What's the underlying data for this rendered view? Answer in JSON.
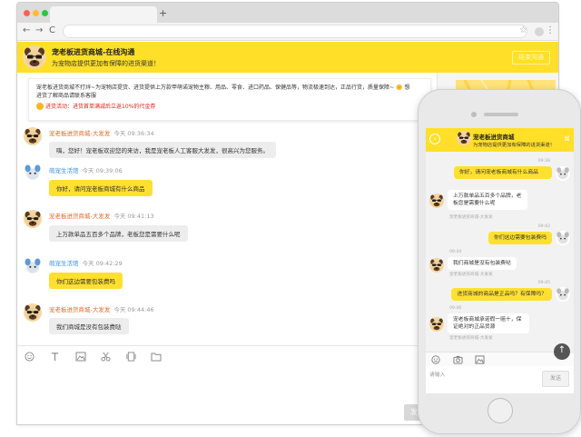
{
  "browser": {
    "new_tab": "+",
    "nav": {
      "back": "←",
      "forward": "→",
      "reload": "C"
    },
    "star": "☆",
    "menu": "⋮"
  },
  "desktop": {
    "header": {
      "title": "宠老板进货商城-在线沟通",
      "subtitle": "为宠物店提供更加有保障的进货渠道！",
      "button": "结束沟通"
    },
    "notice": {
      "text": "宠老板进货商城不打烊~为宠物店提货、进货提供上万款甲萌诺宠物主粮、用品、零食、进口药品、保健品等，物流极速到达，正品行货，质量保障~ 🌼 想进货了解商品请联系客服",
      "promo": "进货活动：进货首单满减后立返10%的代金券"
    },
    "messages": [
      {
        "sender": "宠老板进货商城-大发发",
        "time": "今天 09:36:34",
        "text": "嗨，您好！宠老板欢迎您的来访，我是宠老板人工客服大发发，很高兴为您服务。",
        "role": "agent"
      },
      {
        "sender": "萌宠生活馆",
        "time": "今天 09:39:06",
        "text": "你好，请问宠老板商城有什么商品",
        "role": "customer"
      },
      {
        "sender": "宠老板进货商城-大发发",
        "time": "今天 09:41:13",
        "text": "上万款单品五百多个品牌，老板您是需要什么呢",
        "role": "agent"
      },
      {
        "sender": "萌宠生活馆",
        "time": "今天 09:42:29",
        "text": "你们这边需要包装费吗",
        "role": "customer"
      },
      {
        "sender": "宠老板进货商城-大发发",
        "time": "今天 09:44:46",
        "text": "我们商城是没有包装费哒",
        "role": "agent"
      }
    ],
    "toolbar_icons": [
      "smile-icon",
      "text-icon",
      "image-icon",
      "scissors-icon",
      "file-icon",
      "folder-icon"
    ],
    "send": "发送"
  },
  "mobile": {
    "header": {
      "back": "‹",
      "title": "宠老板进货商城",
      "subtitle": "为宠物店提供更加有保障的进货渠道！",
      "tag": "⌘"
    },
    "messages": [
      {
        "time": "09:38",
        "text": "你好，请问宠老板商城有什么商品",
        "role": "customer"
      },
      {
        "time": "09:40",
        "text": "上万款单品五百多个品牌，老板您是需要什么呢",
        "role": "agent",
        "sender": "宠老板进货商城-大发发"
      },
      {
        "time": "09:42",
        "text": "你们这边需要包装费吗",
        "role": "customer"
      },
      {
        "time": "09:44",
        "text": "我们商城是没有包装费哒",
        "role": "agent",
        "sender": "宠老板进货商城-大发发"
      },
      {
        "time": "09:45",
        "text": "进货商城的商品是正品吗？有保障吗？",
        "role": "customer"
      },
      {
        "time": "09:46",
        "text": "宠老板商城承诺假一赔十，保证绝对的正品货源",
        "role": "agent",
        "sender": "宠老板进货商城-大发发"
      }
    ],
    "input_placeholder": "请输入",
    "send": "发送",
    "fab": "↑"
  },
  "colors": {
    "brand_yellow": "#ffdf28",
    "bubble_yellow": "#ffe030",
    "agent_name": "#e56a2a",
    "customer_name": "#3a8fd8",
    "promo_red": "#e0261a"
  }
}
